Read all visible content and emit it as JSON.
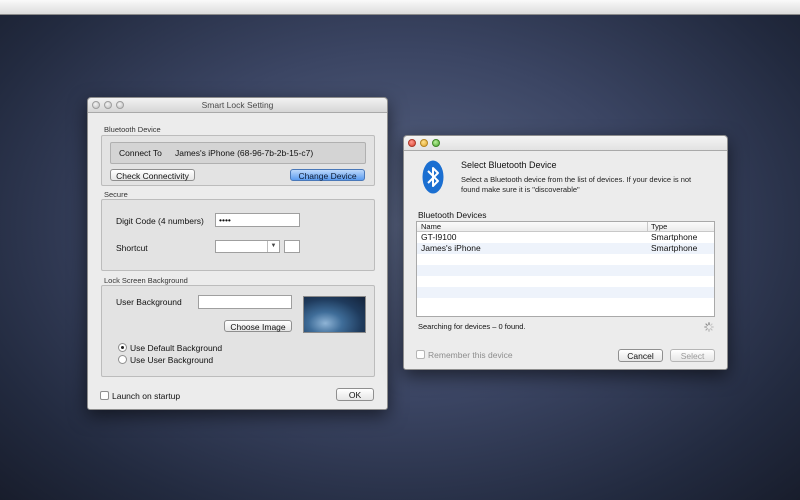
{
  "smart_lock": {
    "title": "Smart Lock Setting",
    "bluetooth_section": "Bluetooth Device",
    "connect_to_label": "Connect To",
    "device_name": "James's iPhone (68-96-7b-2b-15-c7)",
    "check_button": "Check Connectivity",
    "change_button": "Change Device",
    "secure_section": "Secure",
    "digit_code_label": "Digit Code (4 numbers)",
    "digit_code_value": "••••",
    "shortcut_label": "Shortcut",
    "lockscreen_section": "Lock Screen Background",
    "user_bg_label": "User Background",
    "choose_image_button": "Choose Image",
    "radio_default": "Use Default Background",
    "radio_user": "Use User Background",
    "launch_label": "Launch on startup",
    "ok_button": "OK"
  },
  "bt_dialog": {
    "heading": "Select Bluetooth Device",
    "description": "Select a Bluetooth device from the list of devices. If your device is not found make sure it is \"discoverable\"",
    "list_title": "Bluetooth Devices",
    "columns": [
      "Name",
      "Type"
    ],
    "devices": [
      {
        "name": "GT-I9100",
        "type": "Smartphone"
      },
      {
        "name": "James's iPhone",
        "type": "Smartphone"
      }
    ],
    "status": "Searching for devices – 0 found.",
    "remember_label": "Remember this device",
    "cancel_button": "Cancel",
    "select_button": "Select"
  },
  "colors": {
    "accent_blue": "#5b9cf0",
    "bluetooth_blue": "#1b6fd1",
    "row_alt": "#eef3fb"
  },
  "icons": {
    "bluetooth": "bluetooth-icon",
    "spinner": "spinner-icon",
    "dropdown": "chevron-down-icon"
  }
}
